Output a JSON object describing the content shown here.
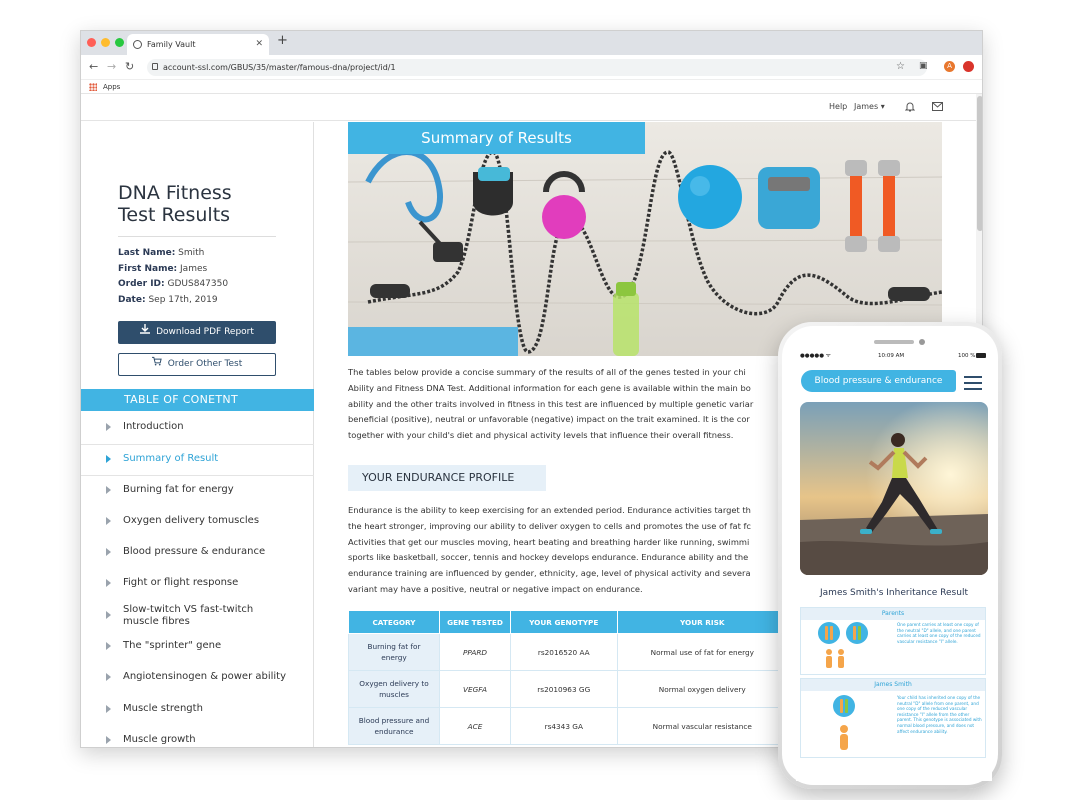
{
  "browser": {
    "tab_title": "Family Vault",
    "new_tab": "+",
    "url": "account-ssl.com/GBUS/35/master/famous-dna/project/id/1",
    "bookmarks_label": "Apps",
    "profile_initial": "A"
  },
  "header": {
    "help": "Help",
    "user": "James ▾"
  },
  "sidebar": {
    "title_line1": "DNA Fitness",
    "title_line2": "Test Results",
    "last_name_label": "Last Name:",
    "last_name": "Smith",
    "first_name_label": "First Name:",
    "first_name": "James",
    "order_id_label": "Order ID:",
    "order_id": "GDUS847350",
    "date_label": "Date:",
    "date": "Sep 17th, 2019",
    "download_label": "Download PDF Report",
    "order_label": "Order Other Test",
    "toc_title": "TABLE OF CONETNT",
    "toc": [
      {
        "label": "Introduction"
      },
      {
        "label": "Summary of Result"
      },
      {
        "label": "Burning fat for energy"
      },
      {
        "label": "Oxygen delivery tomuscles"
      },
      {
        "label": "Blood pressure & endurance"
      },
      {
        "label": "Fight or flight response"
      },
      {
        "label_line1": "Slow-twitch VS fast-twitch",
        "label_line2": "muscle fibres"
      },
      {
        "label": "The \"sprinter\" gene"
      },
      {
        "label": "Angiotensinogen & power ability"
      },
      {
        "label": "Muscle strength"
      },
      {
        "label": "Muscle growth"
      }
    ]
  },
  "main": {
    "banner": "Summary of Results",
    "intro_lines": [
      "The tables below provide a concise summary of the results of all of the genes tested in your chi",
      "Ability and Fitness DNA Test. Additional information for each gene is available within the main bo",
      "ability and the other traits involved in fitness in this test are influenced by multiple genetic variar",
      "beneficial (positive), neutral or unfavorable (negative) impact on the trait examined. It is the cor",
      "together with your child's diet and physical activity levels that influence their overall fitness."
    ],
    "section_title": "YOUR ENDURANCE PROFILE",
    "endurance_lines": [
      "Endurance is the ability to keep exercising for an extended period. Endurance activities target th",
      "the heart stronger, improving our ability to deliver oxygen to cells and promotes the use of fat fc",
      "Activities that get our muscles moving, heart beating and breathing harder like running, swimmi",
      "sports like basketball, soccer, tennis and hockey develops endurance. Endurance ability and the",
      "endurance training are influenced by gender, ethnicity, age, level of physical activity and severa",
      "variant may have a positive, neutral or negative impact on endurance."
    ],
    "table": {
      "headers": [
        "CATEGORY",
        "GENE TESTED",
        "YOUR GENOTYPE",
        "YOUR RISK"
      ],
      "rows": [
        {
          "cat1": "Burning fat for",
          "cat2": "energy",
          "gene": "PPARD",
          "genotype": "rs2016520 AA",
          "risk": "Normal use of fat for energy"
        },
        {
          "cat1": "Oxygen delivery to",
          "cat2": "muscles",
          "gene": "VEGFA",
          "genotype": "rs2010963 GG",
          "risk": "Normal oxygen delivery"
        },
        {
          "cat1": "Blood pressure and",
          "cat2": "endurance",
          "gene": "ACE",
          "genotype": "rs4343 GA",
          "risk": "Normal vascular resistance"
        }
      ]
    }
  },
  "phone": {
    "time": "10:09 AM",
    "battery": "100 %",
    "header": "Blood pressure & endurance",
    "result_title": "James Smith's Inheritance Result",
    "parents_label": "Parents",
    "parents_text": "One parent carries at least one copy of the neutral \"D\" allele, and one parent carries at least one copy of the reduced vascular resistance \"I\" allele.",
    "child_label": "James Smith",
    "child_text": "Your child has inherited one copy of the neutral \"D\" allele from one parent, and one copy of the reduced vascular resistance \"I\" allele from the other parent. This genotype is associated with normal blood pressure, and does not affect endurance ability."
  },
  "colors": {
    "accent": "#41b4e3",
    "navy": "#2f4e6c",
    "light_blue": "#e6f0f8"
  },
  "icons": [
    "favicon-icon",
    "close-icon",
    "back-icon",
    "forward-icon",
    "reload-icon",
    "lock-icon",
    "star-icon",
    "camera-icon",
    "profile-icon",
    "extension-icon",
    "apps-grid-icon",
    "bell-icon",
    "mail-icon",
    "download-icon",
    "cart-icon",
    "chevron-right-icon",
    "menu-icon"
  ]
}
